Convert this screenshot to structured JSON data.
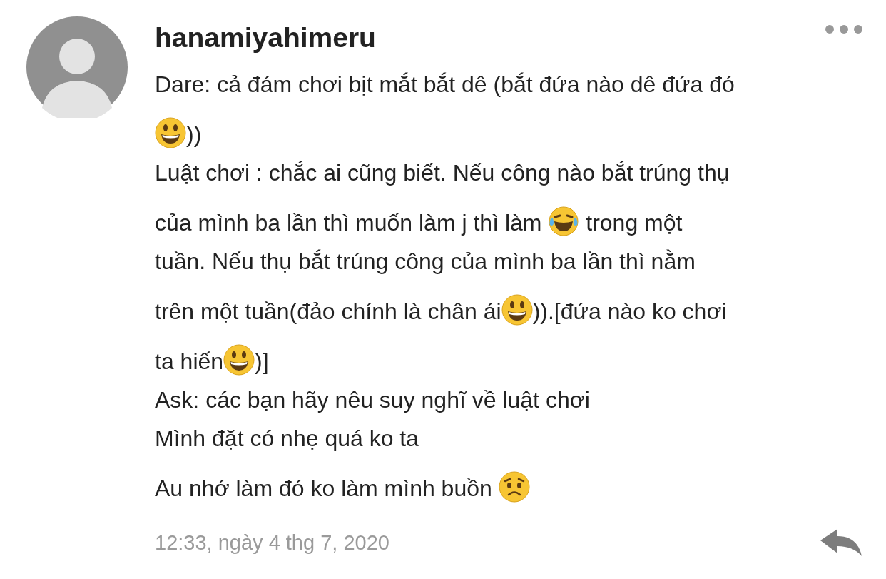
{
  "comment": {
    "username": "hanamiyahimeru",
    "lines": [
      {
        "segments": [
          {
            "kind": "text",
            "text": "Dare: cả đám chơi bịt mắt bắt dê (bắt đứa nào dê đứa đó"
          }
        ]
      },
      {
        "segments": [
          {
            "kind": "grin"
          },
          {
            "kind": "text",
            "text": "))"
          }
        ]
      },
      {
        "segments": [
          {
            "kind": "text",
            "text": "Luật chơi : chắc ai cũng biết. Nếu công nào bắt trúng thụ"
          }
        ]
      },
      {
        "segments": [
          {
            "kind": "text",
            "text": "của mình ba lần thì muốn làm j thì làm "
          },
          {
            "kind": "laugh"
          },
          {
            "kind": "text",
            "text": " trong một"
          }
        ]
      },
      {
        "segments": [
          {
            "kind": "text",
            "text": "tuần. Nếu thụ bắt trúng công của mình ba lần thì nằm"
          }
        ]
      },
      {
        "segments": [
          {
            "kind": "text",
            "text": "trên một tuần(đảo chính là chân ái"
          },
          {
            "kind": "grin"
          },
          {
            "kind": "text",
            "text": ")).[đứa nào ko chơi"
          }
        ]
      },
      {
        "segments": [
          {
            "kind": "text",
            "text": "ta hiến"
          },
          {
            "kind": "grin"
          },
          {
            "kind": "text",
            "text": ")]"
          }
        ]
      },
      {
        "segments": [
          {
            "kind": "text",
            "text": "Ask: các bạn hãy nêu suy nghĩ về luật chơi"
          }
        ]
      },
      {
        "segments": [
          {
            "kind": "text",
            "text": "Mình đặt có nhẹ quá ko ta"
          }
        ]
      },
      {
        "segments": [
          {
            "kind": "text",
            "text": "Au nhớ làm đó ko làm mình buồn "
          },
          {
            "kind": "worried"
          }
        ]
      }
    ],
    "timestamp": "12:33, ngày 4 thg 7, 2020"
  }
}
